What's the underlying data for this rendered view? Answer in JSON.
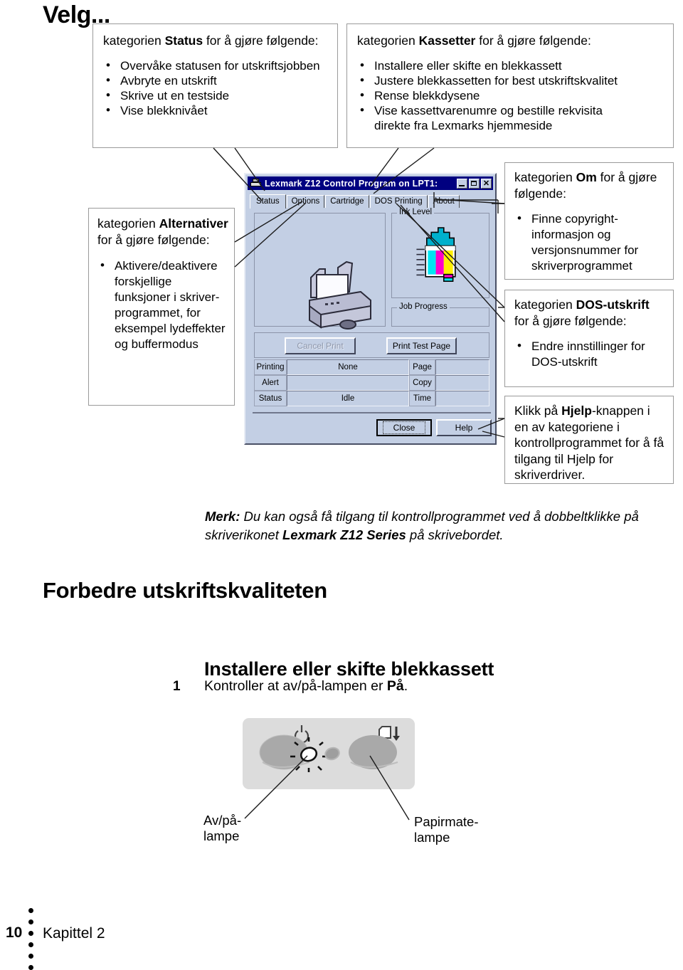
{
  "page": {
    "title": "Velg...",
    "folio_number": "10",
    "folio_text": "Kapittel 2"
  },
  "callouts": {
    "status": {
      "head_prefix": "kategorien ",
      "head_bold": "Status",
      "head_suffix": " for å gjøre følgende:",
      "items": [
        "Overvåke statusen for utskriftsjobben",
        "Avbryte en utskrift",
        "Skrive ut en testside",
        "Vise blekknivået"
      ]
    },
    "kassetter": {
      "head_prefix": "kategorien ",
      "head_bold": "Kassetter",
      "head_suffix": " for å gjøre følgende:",
      "items": [
        "Installere eller skifte en blekkassett",
        "Justere blekkassetten for best utskriftskvalitet",
        "Rense blekkdysene",
        "Vise kassettvarenumre og bestille rekvisita direkte fra Lexmarks hjemmeside"
      ]
    },
    "alternativer": {
      "head_prefix": "kategorien ",
      "head_bold": "Alternativer",
      "head_suffix": " for å gjøre følgende:",
      "items": [
        "Aktivere/deaktivere forskjellige funksjoner i skriver- programmet, for eksempel lydeffekter og buffermodus"
      ]
    },
    "om": {
      "head_prefix": "kategorien ",
      "head_bold": "Om",
      "head_suffix": " for å gjøre følgende:",
      "items": [
        "Finne copyright- informasjon og versjonsnummer for skriverprogrammet"
      ]
    },
    "dos": {
      "head_prefix": "kategorien ",
      "head_bold": "DOS-utskrift",
      "head_suffix": " for å gjøre følgende:",
      "items": [
        "Endre innstillinger for DOS-utskrift"
      ]
    },
    "hjelp": {
      "prefix": "Klikk på ",
      "bold": "Hjelp",
      "suffix": "-knappen i en av kategoriene i kontrollprogrammet for å få tilgang til Hjelp for skriverdriver."
    }
  },
  "dialog": {
    "title": "Lexmark Z12 Control Program on LPT1:",
    "window_buttons": [
      "minimize",
      "maximize",
      "close"
    ],
    "tabs": [
      "Status",
      "Options",
      "Cartridge",
      "DOS Printing",
      "About"
    ],
    "active_tab": "Status",
    "group_ink_level": "Ink Level",
    "group_job_progress": "Job Progress",
    "buttons": {
      "cancel_print": "Cancel Print",
      "print_test_page": "Print Test Page",
      "close": "Close",
      "help": "Help"
    },
    "status_rows": [
      {
        "label": "Printing",
        "value": "None",
        "right_label": "Page",
        "right_value": ""
      },
      {
        "label": "Alert",
        "value": "",
        "right_label": "Copy",
        "right_value": ""
      },
      {
        "label": "Status",
        "value": "Idle",
        "right_label": "Time",
        "right_value": ""
      }
    ],
    "ink_colors": [
      "#00cfe8",
      "#ff00c8",
      "#ffe800"
    ],
    "title_bar_color": "#000080",
    "face_color": "#c3cfe4"
  },
  "note": {
    "bold": "Merk:",
    "text_1": " Du kan også få tilgang til kontrollprogrammet ved å dobbeltklikke på skriverikonet ",
    "bold_2": "Lexmark Z12 Series",
    "text_2": " på skrivebordet."
  },
  "sections": {
    "h1": "Forbedre utskriftskvaliteten",
    "h2": "Installere eller skifte blekkassett",
    "step_number": "1",
    "step_prefix": "Kontroller at av/på-lampen er ",
    "step_bold": "På",
    "step_suffix": "."
  },
  "control_panel": {
    "power_caption_line1": "Av/på-",
    "power_caption_line2": "lampe",
    "paper_caption_line1": "Papirmate-",
    "paper_caption_line2": "lampe",
    "power_icon": "power-icon",
    "paper_feed_icon": "paper-feed-icon"
  }
}
